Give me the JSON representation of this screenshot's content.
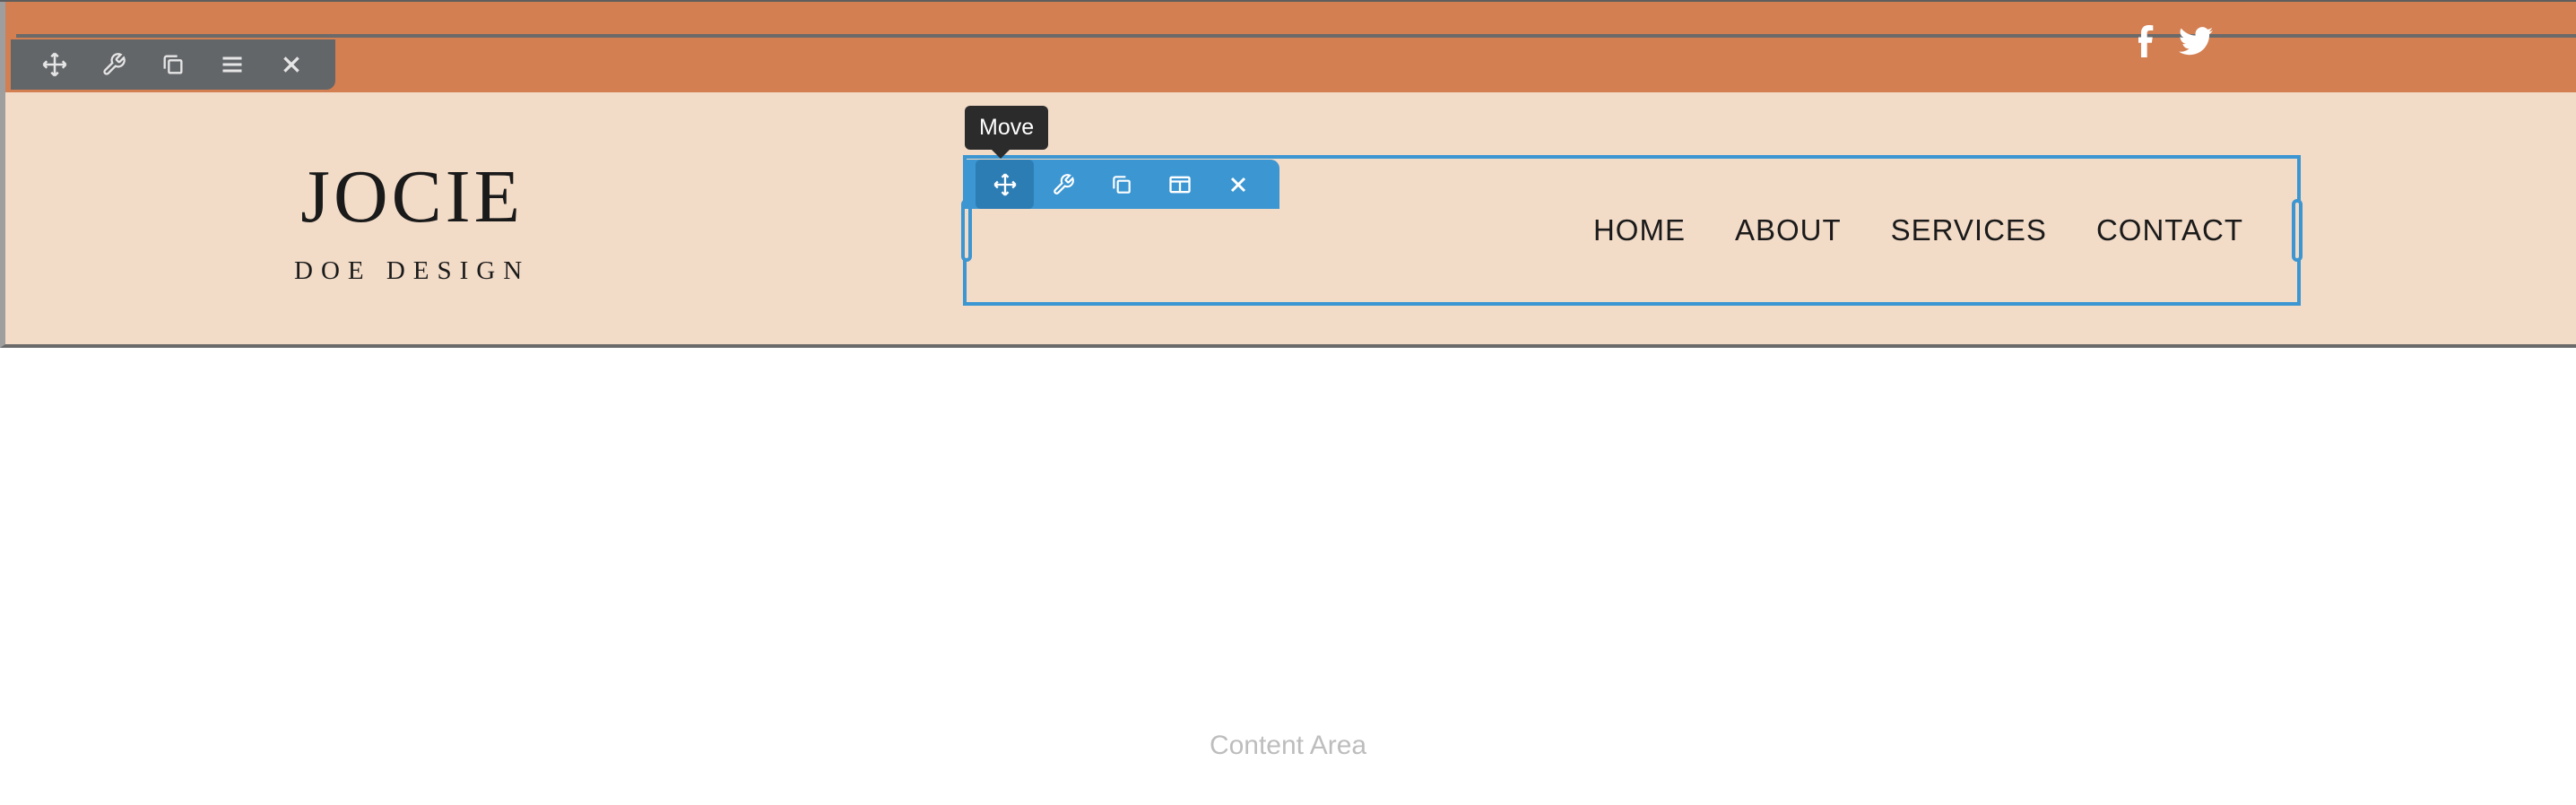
{
  "colors": {
    "orange_bar": "#d37f52",
    "header_bg": "#f2dbc7",
    "toolbar_dark": "#636669",
    "toolbar_blue": "#3b96d2",
    "selection_border": "#3b96d2",
    "tooltip_bg": "#2b2b2b"
  },
  "social": {
    "items": [
      "facebook-icon",
      "twitter-icon"
    ]
  },
  "dark_toolbar": {
    "tools": [
      "move-icon",
      "wrench-icon",
      "columns-icon",
      "menu-icon",
      "close-icon"
    ]
  },
  "blue_toolbar": {
    "tools": [
      "move-icon",
      "wrench-icon",
      "copy-icon",
      "layout-icon",
      "close-icon"
    ],
    "active_index": 0
  },
  "tooltip": {
    "text": "Move"
  },
  "logo": {
    "title": "JOCIE",
    "subtitle": "DOE DESIGN"
  },
  "nav": {
    "items": [
      {
        "label": "HOME"
      },
      {
        "label": "ABOUT"
      },
      {
        "label": "SERVICES"
      },
      {
        "label": "CONTACT"
      }
    ]
  },
  "content": {
    "placeholder": "Content Area"
  }
}
